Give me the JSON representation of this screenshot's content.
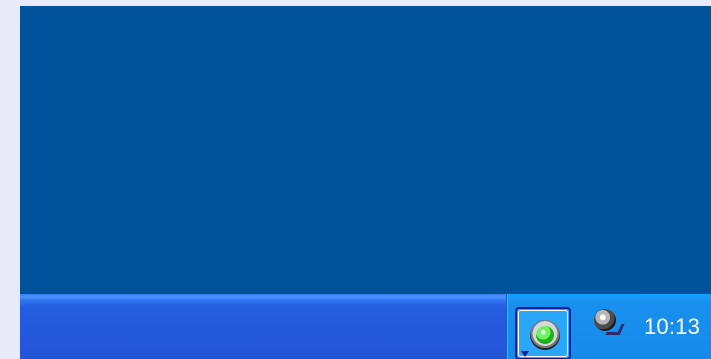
{
  "screen": {
    "desktop_color": "#00529B",
    "taskbar_color": "#245FE0",
    "tray_color": "#168AE9"
  },
  "tray": {
    "icons": [
      {
        "name": "green-status-icon",
        "focused": true
      },
      {
        "name": "speaker-icon",
        "focused": false
      }
    ],
    "clock": "10:13"
  }
}
